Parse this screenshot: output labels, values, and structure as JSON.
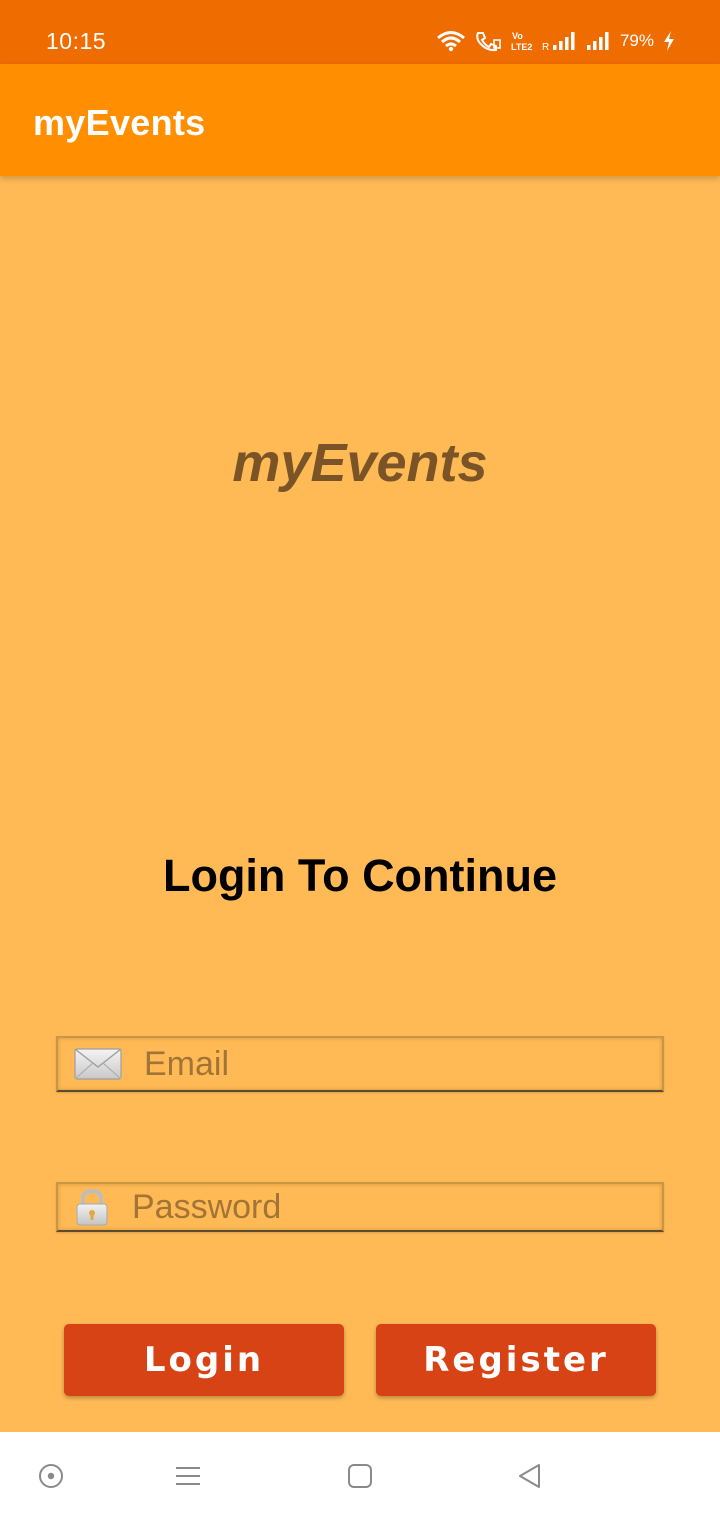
{
  "status_bar": {
    "time": "10:15",
    "battery": "79%",
    "network_label": "Vo LTE2",
    "icons": [
      "wifi-icon",
      "wifi-calling-icon",
      "volte-icon",
      "signal-roaming-icon",
      "signal-icon",
      "battery-charging-icon"
    ]
  },
  "app_bar": {
    "title": "myEvents"
  },
  "main": {
    "logo_text": "myEvents",
    "heading": "Login To Continue",
    "email_placeholder": "Email",
    "email_value": "",
    "password_placeholder": "Password",
    "password_value": "",
    "login_label": "Login",
    "register_label": "Register"
  },
  "nav_bar": {
    "items": [
      "assistant-icon",
      "recents-menu-icon",
      "home-icon",
      "back-icon"
    ]
  },
  "colors": {
    "status_bar": "#EF6C00",
    "app_bar": "#FF8F00",
    "background": "#FFBA55",
    "button": "#D84315",
    "logo_text": "#7A5426"
  }
}
